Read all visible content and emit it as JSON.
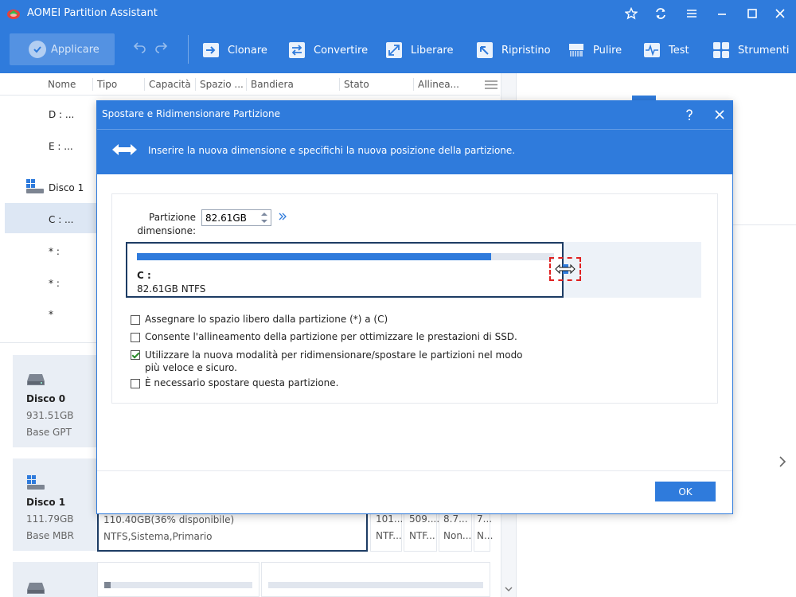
{
  "app": {
    "title": "AOMEI Partition Assistant"
  },
  "toolbar": {
    "apply_label": "Applicare",
    "items": [
      {
        "label": "Clonare",
        "icon": "clone-icon"
      },
      {
        "label": "Convertire",
        "icon": "convert-icon"
      },
      {
        "label": "Liberare",
        "icon": "free-up-icon"
      },
      {
        "label": "Ripristino",
        "icon": "recovery-icon"
      },
      {
        "label": "Pulire",
        "icon": "wipe-icon"
      },
      {
        "label": "Test",
        "icon": "test-icon"
      },
      {
        "label": "Strumenti",
        "icon": "tools-icon"
      }
    ]
  },
  "table": {
    "columns": [
      "Nome",
      "Tipo",
      "Capacità",
      "Spazio ...",
      "Bandiera",
      "Stato",
      "Allinea..."
    ],
    "rows": [
      {
        "name": "D : ..."
      },
      {
        "name": "E : ..."
      },
      {
        "name": "Disco 1"
      },
      {
        "name": "C : ..."
      },
      {
        "name": "* :"
      },
      {
        "name": "* :"
      },
      {
        "name": "*"
      }
    ]
  },
  "disks": [
    {
      "name": "Disco 0",
      "size": "931.51GB",
      "type": "Base GPT"
    },
    {
      "name": "Disco 1",
      "size": "111.79GB",
      "type": "Base MBR"
    }
  ],
  "disk1_map": {
    "main_line1": "110.40GB(36% disponibile)",
    "main_line2": "NTFS,Sistema,Primario",
    "cells": [
      {
        "top": "101....",
        "bottom": "NTF..."
      },
      {
        "top": "509....",
        "bottom": "NTF..."
      },
      {
        "top": "8.7...",
        "bottom": "Non..."
      },
      {
        "top": "7...",
        "bottom": "N..."
      }
    ]
  },
  "dialog": {
    "title": "Spostare e Ridimensionare Partizione",
    "description": "Inserire la nuova dimensione e specifichi la nuova posizione della partizione.",
    "size_label_line1": "Partizione",
    "size_label_line2": "dimensione:",
    "size_value": "82.61GB",
    "partition_letter": "C :",
    "partition_info": "82.61GB NTFS",
    "bar_fill_fraction": 0.85,
    "options": [
      {
        "text": "Assegnare lo spazio libero dalla partizione (*) a (C)",
        "checked": false
      },
      {
        "text": "Consente l'allineamento della partizione per ottimizzare le prestazioni di SSD.",
        "checked": false
      },
      {
        "text": "Utilizzare la nuova modalità per ridimensionare/spostare le partizioni nel modo",
        "text2": "più veloce e sicuro.",
        "checked": true
      },
      {
        "text": "È necessario spostare questa partizione.",
        "checked": false
      }
    ],
    "ok_label": "OK"
  },
  "colors": {
    "accent": "#2f7bdc",
    "selected_row": "#dde7f4",
    "focus_border": "#e02020"
  }
}
